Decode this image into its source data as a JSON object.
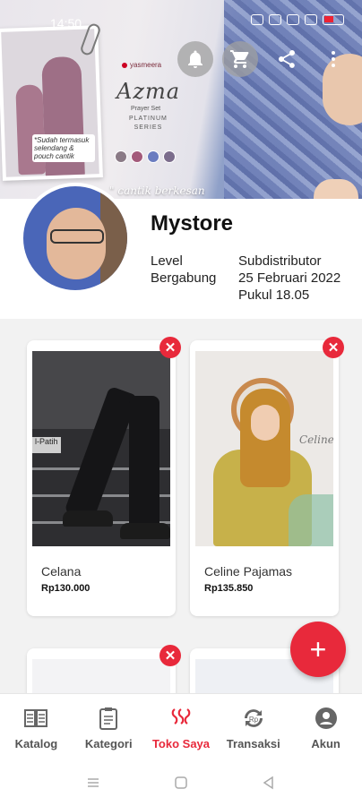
{
  "status_bar": {
    "time": "14:50"
  },
  "banner": {
    "brand": "yasmeera",
    "title": "Azma",
    "subtitle": "Prayer Set",
    "series_line1": "PLATINUM",
    "series_line2": "SERIES",
    "photo_caption": "*Sudah termasuk selendang & pouch cantik",
    "tagline": "cantik berkesan",
    "swatch_colors": [
      "#8a7a86",
      "#a35a7a",
      "#6a7cc0",
      "#7b6c8c"
    ]
  },
  "header_actions": [
    {
      "name": "notification-button",
      "icon": "bell-icon"
    },
    {
      "name": "cart-button",
      "icon": "cart-icon"
    },
    {
      "name": "share-button",
      "icon": "share-icon"
    },
    {
      "name": "more-button",
      "icon": "more-vertical-icon"
    }
  ],
  "profile": {
    "store_name": "Mystore",
    "level_label": "Level",
    "level_value": "Subdistributor",
    "joined_label": "Bergabung",
    "joined_date": "25 Februari 2022",
    "joined_time": "Pukul 18.05"
  },
  "products": [
    {
      "name": "Celana",
      "price": "Rp130.000",
      "remove_label": "✕",
      "image_label": "l-Patih"
    },
    {
      "name": "Celine Pajamas",
      "price": "Rp135.850",
      "remove_label": "✕",
      "image_label": "Celine"
    }
  ],
  "more_products_remove_label": "✕",
  "fab": {
    "label": "+"
  },
  "bottom_nav": [
    {
      "label": "Katalog",
      "icon": "catalog-icon",
      "active": false
    },
    {
      "label": "Kategori",
      "icon": "category-icon",
      "active": false
    },
    {
      "label": "Toko Saya",
      "icon": "store-icon",
      "active": true
    },
    {
      "label": "Transaksi",
      "icon": "transaction-icon",
      "active": false
    },
    {
      "label": "Akun",
      "icon": "account-icon",
      "active": false
    }
  ],
  "colors": {
    "accent": "#e8293b",
    "background": "#f2f2f2",
    "card": "#ffffff"
  }
}
